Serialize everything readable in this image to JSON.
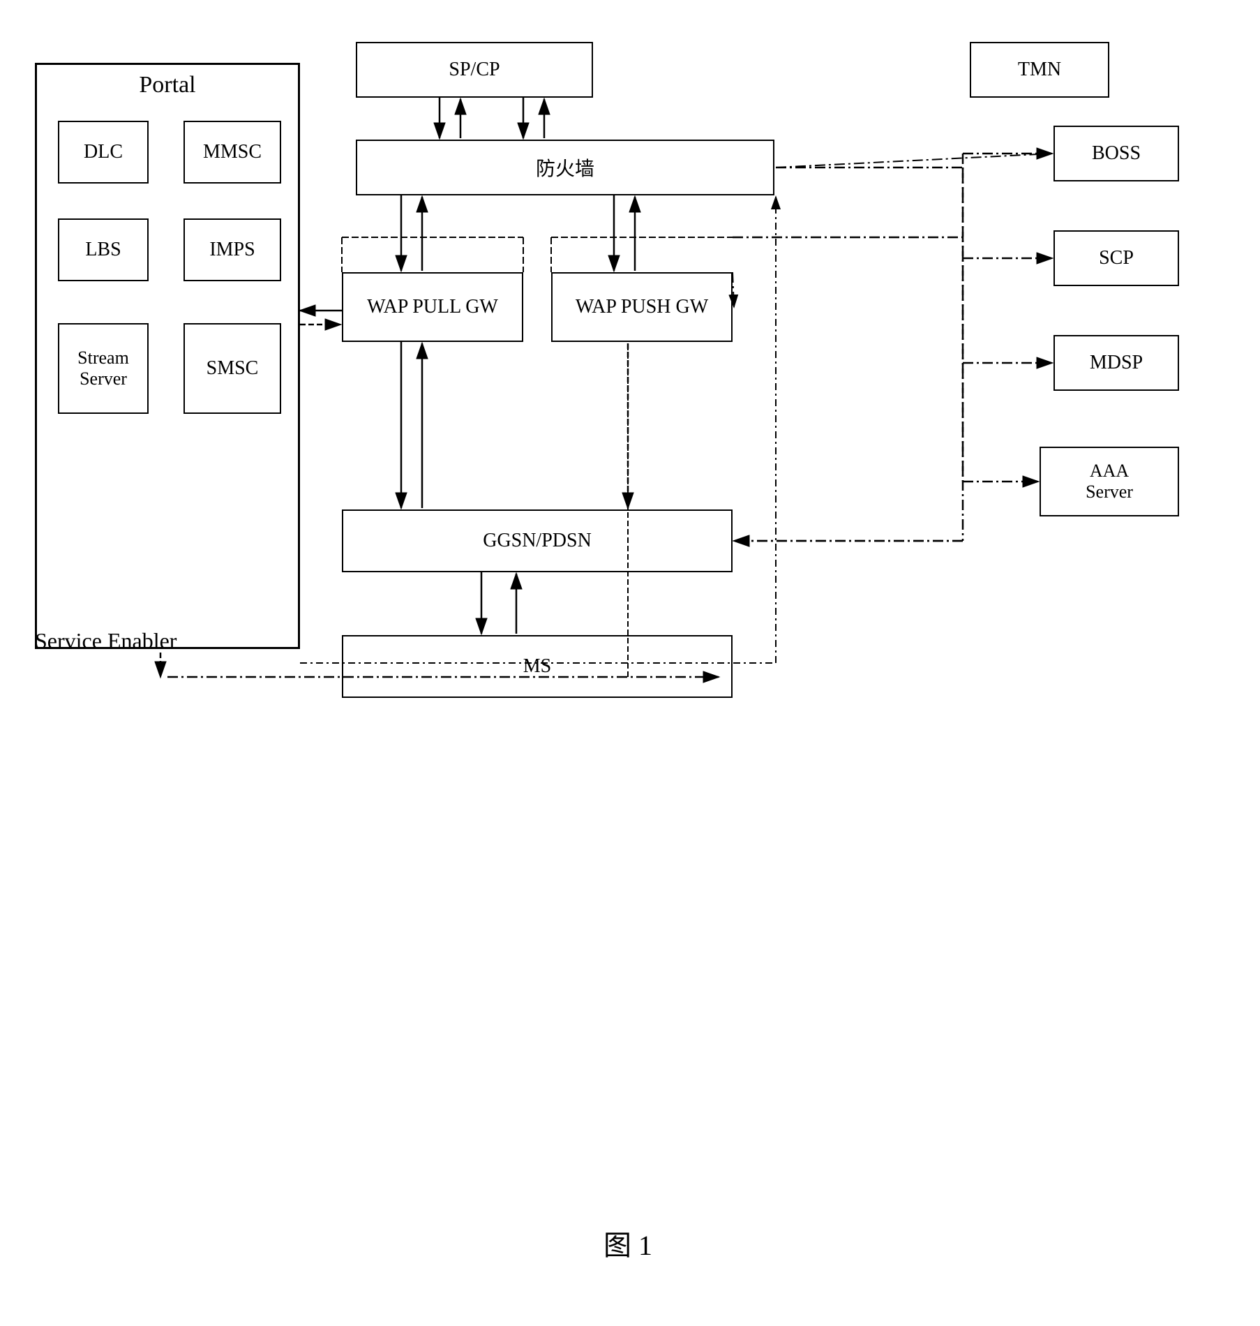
{
  "diagram": {
    "title": "图 1",
    "boxes": {
      "portal": {
        "label": "Portal"
      },
      "dlc": {
        "label": "DLC"
      },
      "mmsc": {
        "label": "MMSC"
      },
      "lbs": {
        "label": "LBS"
      },
      "imps": {
        "label": "IMPS"
      },
      "stream_server": {
        "label": "Stream\nServer"
      },
      "smsc": {
        "label": "SMSC"
      },
      "service_enabler": {
        "label": "Service Enabler"
      },
      "sp_cp": {
        "label": "SP/CP"
      },
      "firewall": {
        "label": "防火墙"
      },
      "wap_pull_gw": {
        "label": "WAP PULL GW"
      },
      "wap_push_gw": {
        "label": "WAP PUSH GW"
      },
      "ggsn_pdsn": {
        "label": "GGSN/PDSN"
      },
      "ms": {
        "label": "MS"
      },
      "tmn": {
        "label": "TMN"
      },
      "boss": {
        "label": "BOSS"
      },
      "scp": {
        "label": "SCP"
      },
      "mdsp": {
        "label": "MDSP"
      },
      "aaa_server": {
        "label": "AAA\nServer"
      }
    }
  }
}
